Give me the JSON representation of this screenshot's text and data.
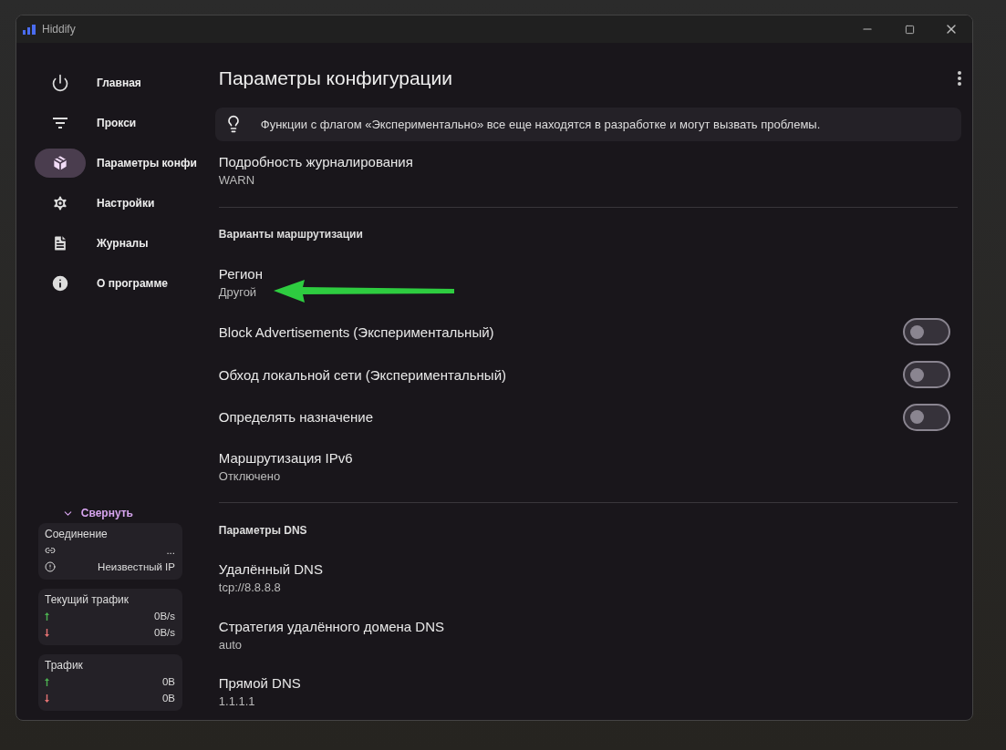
{
  "window": {
    "title": "Hiddify"
  },
  "sidebar": {
    "items": [
      {
        "label": "Главная",
        "selected": false
      },
      {
        "label": "Прокси",
        "selected": false
      },
      {
        "label": "Параметры конфи",
        "selected": true
      },
      {
        "label": "Настройки",
        "selected": false
      },
      {
        "label": "Журналы",
        "selected": false
      },
      {
        "label": "О программе",
        "selected": false
      }
    ],
    "collapse": "Свернуть",
    "cards": [
      {
        "title": "Соединение",
        "rows": [
          {
            "kind": "link",
            "value": "..."
          },
          {
            "kind": "info",
            "value": "Неизвестный IP"
          }
        ]
      },
      {
        "title": "Текущий трафик",
        "rows": [
          {
            "kind": "up",
            "value": "0B/s"
          },
          {
            "kind": "down",
            "value": "0B/s"
          }
        ]
      },
      {
        "title": "Трафик",
        "rows": [
          {
            "kind": "up",
            "value": "0B"
          },
          {
            "kind": "down",
            "value": "0B"
          }
        ]
      }
    ]
  },
  "main": {
    "title": "Параметры конфигурации",
    "notice": "Функции с флагом «Экспериментально» все еще находятся в разработке и могут вызвать проблемы.",
    "sections": [
      {
        "items": [
          {
            "kind": "value",
            "title": "Подробность журналирования",
            "value": "WARN"
          }
        ]
      },
      {
        "heading": "Варианты маршрутизации",
        "items": [
          {
            "kind": "value",
            "title": "Регион",
            "value": "Другой"
          },
          {
            "kind": "toggle",
            "title": "Block Advertisements (Экспериментальный)",
            "on": false
          },
          {
            "kind": "toggle",
            "title": "Обход локальной сети (Экспериментальный)",
            "on": false
          },
          {
            "kind": "toggle",
            "title": "Определять назначение",
            "on": false
          },
          {
            "kind": "value",
            "title": "Маршрутизация IPv6",
            "value": "Отключено"
          }
        ]
      },
      {
        "heading": "Параметры DNS",
        "items": [
          {
            "kind": "value",
            "title": "Удалённый DNS",
            "value": "tcp://8.8.8.8"
          },
          {
            "kind": "value",
            "title": "Стратегия удалённого домена DNS",
            "value": "auto"
          },
          {
            "kind": "value",
            "title": "Прямой DNS",
            "value": "1.1.1.1"
          }
        ]
      }
    ]
  }
}
